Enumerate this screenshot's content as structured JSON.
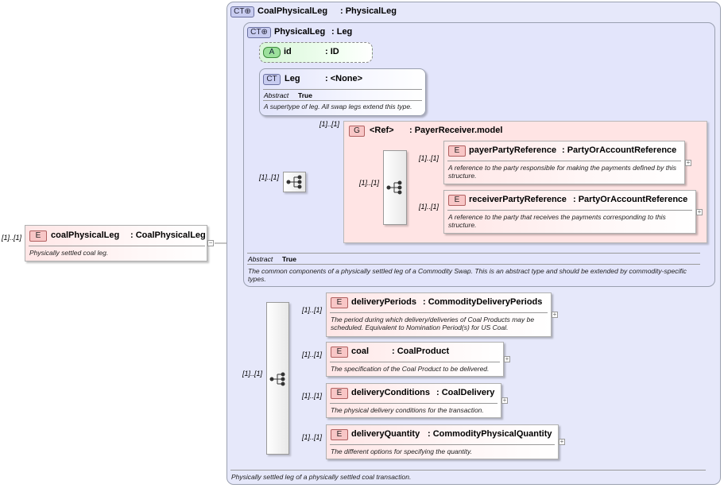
{
  "root_element": {
    "badge": "E",
    "name": "coalPhysicalLeg",
    "type": ": CoalPhysicalLeg",
    "doc": "Physically settled coal leg.",
    "occurrence": "[1]..[1]"
  },
  "outer_type": {
    "badge": "CT",
    "name": "CoalPhysicalLeg",
    "type": ": PhysicalLeg",
    "doc": "Physically settled leg of a physically settled coal transaction."
  },
  "inner_type": {
    "badge": "CT",
    "name": "PhysicalLeg",
    "type": ": Leg",
    "abstract_label": "Abstract",
    "abstract_value": "True",
    "doc": "The common components of a physically settled leg of a Commodity Swap. This is an abstract type and should be extended by commodity-specific types."
  },
  "attribute_id": {
    "badge": "A",
    "name": "id",
    "type": ": ID"
  },
  "leg_type": {
    "badge": "CT",
    "name": "Leg",
    "type": ": <None>",
    "abstract_label": "Abstract",
    "abstract_value": "True",
    "doc": "A supertype of leg. All swap legs extend this type."
  },
  "group_ref": {
    "badge": "G",
    "name": "<Ref>",
    "type": ": PayerReceiver.model",
    "occurrence": "[1]..[1]",
    "seq_occurrence": "[1]..[1]",
    "inner_seq_occurrence": "[1]..[1]",
    "elements": [
      {
        "badge": "E",
        "name": "payerPartyReference",
        "type": ": PartyOrAccountReference",
        "doc": "A reference to the party responsible for making the payments defined by this structure.",
        "occurrence": "[1]..[1]"
      },
      {
        "badge": "E",
        "name": "receiverPartyReference",
        "type": ": PartyOrAccountReference",
        "doc": "A reference to the party that receives the payments corresponding to this structure.",
        "occurrence": "[1]..[1]"
      }
    ]
  },
  "main_sequence": {
    "occurrence": "[1]..[1]",
    "elements": [
      {
        "badge": "E",
        "name": "deliveryPeriods",
        "type": ": CommodityDeliveryPeriods",
        "doc": "The period during which delivery/deliveries of Coal Products may be scheduled. Equivalent to Nomination Period(s) for US Coal.",
        "occurrence": "[1]..[1]"
      },
      {
        "badge": "E",
        "name": "coal",
        "type": ": CoalProduct",
        "doc": "The specification of the Coal Product to be delivered.",
        "occurrence": "[1]..[1]"
      },
      {
        "badge": "E",
        "name": "deliveryConditions",
        "type": ": CoalDelivery",
        "doc": "The physical delivery conditions for the transaction.",
        "occurrence": "[1]..[1]"
      },
      {
        "badge": "E",
        "name": "deliveryQuantity",
        "type": ": CommodityPhysicalQuantity",
        "doc": "The different options for specifying the quantity.",
        "occurrence": "[1]..[1]"
      }
    ]
  },
  "colors": {
    "element_fill": "#ffe6e6",
    "type_fill": "#e6e8fa",
    "attribute_fill": "#d8f6d8",
    "group_fill": "#ffe4e4"
  },
  "icons": {
    "sequence": "sequence-icon",
    "expand": "expand-icon",
    "collapse": "collapse-icon"
  }
}
